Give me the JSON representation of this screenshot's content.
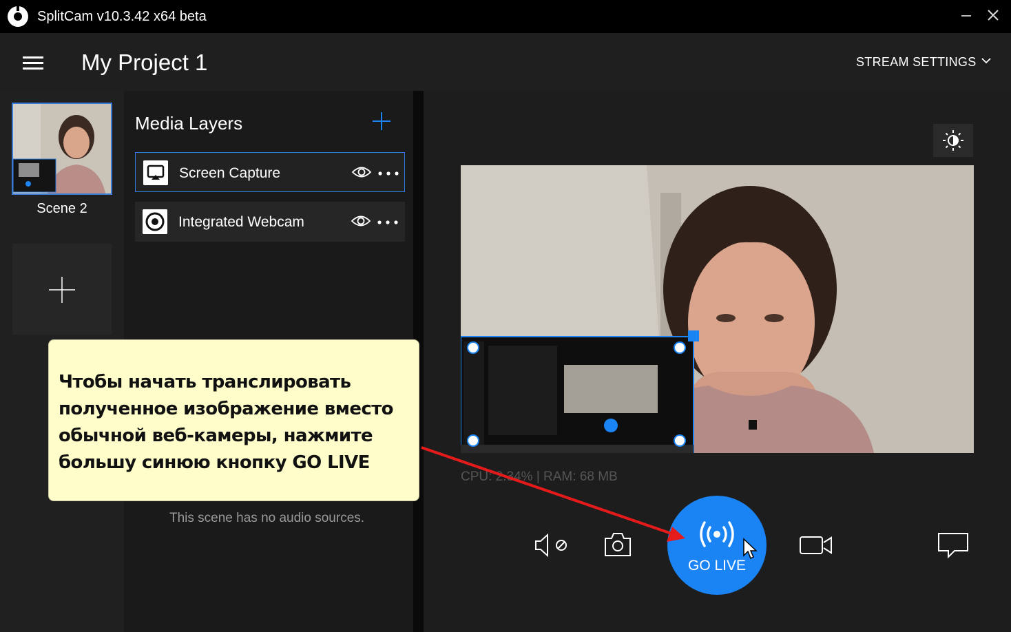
{
  "window": {
    "title": "SplitCam v10.3.42 x64 beta"
  },
  "header": {
    "project_title": "My Project 1",
    "stream_settings_label": "STREAM SETTINGS"
  },
  "scenes": {
    "items": [
      {
        "label": "Scene 2"
      }
    ]
  },
  "media_layers": {
    "title": "Media Layers",
    "items": [
      {
        "label": "Screen Capture",
        "selected": true,
        "icon": "screen-capture-icon"
      },
      {
        "label": "Integrated Webcam",
        "selected": false,
        "icon": "webcam-icon"
      }
    ],
    "no_audio_text": "This scene has no audio sources."
  },
  "preview": {
    "stats": "CPU: 2.34% | RAM: 68 MB"
  },
  "controls": {
    "go_live_label": "GO LIVE"
  },
  "tooltip": {
    "text": "Чтобы начать транслировать полученное изображение вместо обычной веб-камеры, нажмите большу синюю кнопку GO LIVE"
  },
  "colors": {
    "accent": "#1a84f5",
    "selected_border": "#2f7de1",
    "tooltip_bg": "#fffeca",
    "arrow": "#e51b1b"
  }
}
